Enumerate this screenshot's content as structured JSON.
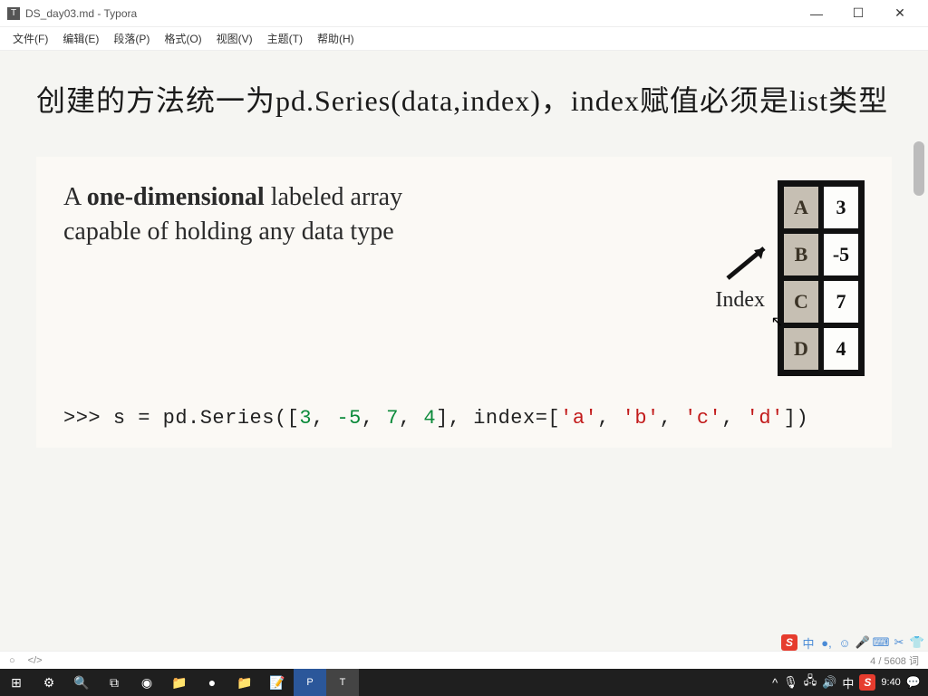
{
  "window": {
    "title": "DS_day03.md - Typora"
  },
  "menu": {
    "file": "文件(F)",
    "edit": "编辑(E)",
    "para": "段落(P)",
    "format": "格式(O)",
    "view": "视图(V)",
    "theme": "主题(T)",
    "help": "帮助(H)"
  },
  "content": {
    "heading": "创建的方法统一为pd.Series(data,index)，index赋值必须是list类型",
    "diagram_text_1a": "A ",
    "diagram_text_1b": "one-dimensional",
    "diagram_text_1c": " labeled array",
    "diagram_text_2": "capable of holding any data type",
    "index_label": "Index",
    "series": {
      "index": [
        "A",
        "B",
        "C",
        "D"
      ],
      "values": [
        "3",
        "-5",
        "7",
        "4"
      ]
    },
    "code": {
      "prompt": ">>> ",
      "assign": "s = pd.Series([",
      "nums": [
        "3",
        "-5",
        "7",
        "4"
      ],
      "mid": "], index=[",
      "strs": [
        "'a'",
        "'b'",
        "'c'",
        "'d'"
      ],
      "end": "])"
    }
  },
  "status": {
    "outline_icon": "○",
    "source_icon": "</>",
    "words": "4 / 5608 词"
  },
  "tray": {
    "s": "S",
    "cn": "中",
    "icons": [
      "☺",
      "🎤",
      "⌨",
      "✂",
      "👕"
    ]
  },
  "taskbar": {
    "start": "⊞",
    "items": [
      "⚙",
      "🔍",
      "⧉",
      "⌂",
      "📁",
      "●",
      "📁",
      "📝",
      "💻",
      "📘",
      "◼"
    ],
    "tray": {
      "up": "^",
      "mic": "🎙",
      "net": "🖧",
      "vol": "🔊",
      "ime": "中",
      "s": "S",
      "time": "9:40",
      "notif": "💬"
    }
  }
}
